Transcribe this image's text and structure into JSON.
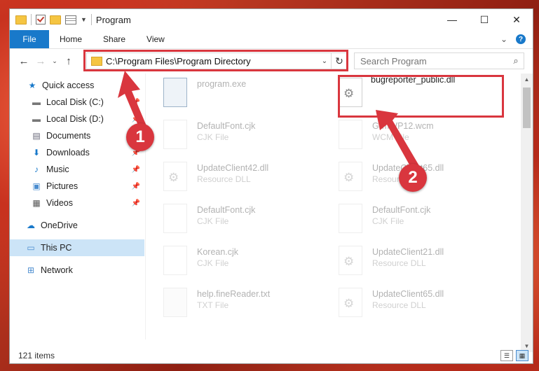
{
  "title_bar": {
    "title": "Program"
  },
  "window_controls": {
    "minimize": "—",
    "maximize": "☐",
    "close": "✕"
  },
  "ribbon": {
    "tabs": [
      "File",
      "Home",
      "Share",
      "View"
    ]
  },
  "address_bar": {
    "path": "C:\\Program Files\\Program Directory"
  },
  "search": {
    "placeholder": "Search Program"
  },
  "sidebar": {
    "items": [
      {
        "label": "Quick access",
        "icon": "star-icon",
        "pinned": false
      },
      {
        "label": "Local Disk (C:)",
        "icon": "drive-icon",
        "pinned": true
      },
      {
        "label": "Local Disk (D:)",
        "icon": "drive-icon",
        "pinned": true
      },
      {
        "label": "Documents",
        "icon": "document-icon",
        "pinned": true
      },
      {
        "label": "Downloads",
        "icon": "download-icon",
        "pinned": true
      },
      {
        "label": "Music",
        "icon": "music-icon",
        "pinned": true
      },
      {
        "label": "Pictures",
        "icon": "picture-icon",
        "pinned": true
      },
      {
        "label": "Videos",
        "icon": "video-icon",
        "pinned": true
      },
      {
        "label": "OneDrive",
        "icon": "cloud-icon",
        "pinned": false
      },
      {
        "label": "This PC",
        "icon": "pc-icon",
        "pinned": false,
        "selected": true
      },
      {
        "label": "Network",
        "icon": "network-icon",
        "pinned": false
      }
    ]
  },
  "files": [
    {
      "name": "program.exe",
      "type": "",
      "icon": "exe-icon",
      "highlighted": false
    },
    {
      "name": "bugreporter_public.dll",
      "type": "",
      "icon": "gear-file-icon",
      "highlighted": true
    },
    {
      "name": "DefaultFont.cjk",
      "type": "CJK File",
      "icon": "blank-file-icon"
    },
    {
      "name": "GrmWP12.wcm",
      "type": "WCM File",
      "icon": "blank-file-icon"
    },
    {
      "name": "UpdateClient42.dll",
      "type": "Resource DLL",
      "icon": "gear-file-icon"
    },
    {
      "name": "UpdateClient65.dll",
      "type": "Resource DLL",
      "icon": "gear-file-icon"
    },
    {
      "name": "DefaultFont.cjk",
      "type": "CJK File",
      "icon": "blank-file-icon"
    },
    {
      "name": "DefaultFont.cjk",
      "type": "CJK File",
      "icon": "blank-file-icon"
    },
    {
      "name": "Korean.cjk",
      "type": "CJK File",
      "icon": "blank-file-icon"
    },
    {
      "name": "UpdateClient21.dll",
      "type": "Resource DLL",
      "icon": "gear-file-icon"
    },
    {
      "name": "help.fineReader.txt",
      "type": "TXT File",
      "icon": "text-file-icon"
    },
    {
      "name": "UpdateClient65.dll",
      "type": "Resource DLL",
      "icon": "gear-file-icon"
    }
  ],
  "status": {
    "item_count": "121 items"
  },
  "markers": {
    "first": "1",
    "second": "2"
  },
  "colors": {
    "accent": "#1979ca",
    "highlight": "#d9363e",
    "selection": "#cce4f7"
  }
}
